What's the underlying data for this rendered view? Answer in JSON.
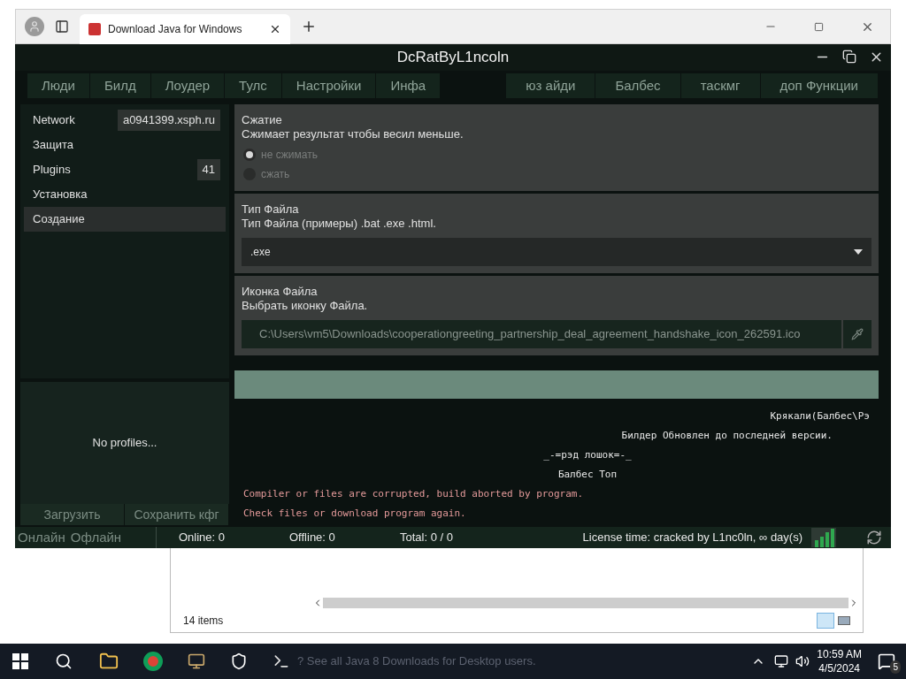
{
  "browser": {
    "tabs": [
      {
        "title": "Download Java for Windows",
        "selected": true
      }
    ]
  },
  "app": {
    "title": "DcRatByL1ncoln",
    "menu_left": [
      "Люди",
      "Билд",
      "Лоудер",
      "Тулс",
      "Настройки",
      "Инфа"
    ],
    "menu_right": [
      "юз айди",
      "Балбес",
      "таскмг",
      "доп Функции"
    ],
    "sidebar": {
      "items": [
        {
          "label": "Network",
          "value": "a0941399.xsph.ru",
          "selected": false
        },
        {
          "label": "Защита",
          "selected": false
        },
        {
          "label": "Plugins",
          "value": "41",
          "selected": false
        },
        {
          "label": "Установка",
          "selected": false
        },
        {
          "label": "Создание",
          "selected": true
        }
      ],
      "profiles_empty": "No profiles...",
      "buttons": [
        "Загрузить",
        "Сохранить кфг"
      ]
    },
    "sections": [
      {
        "kind": "radio",
        "title": "Сжатие",
        "description": "Сжимает результат чтобы весил меньше.",
        "options": [
          {
            "label": "не сжимать",
            "selected": true
          },
          {
            "label": "сжать",
            "selected": false
          }
        ]
      },
      {
        "kind": "select",
        "title": "Тип Файла",
        "description": "Тип Файла (примеры) .bat .exe .html.",
        "value": ".exe"
      },
      {
        "kind": "file",
        "title": "Иконка Файла",
        "description": "Выбрать иконку Файла.",
        "value": "C:\\Users\\vm5\\Downloads\\cooperationgreeting_partnership_deal_agreement_handshake_icon_262591.ico"
      }
    ],
    "log": [
      {
        "kind": "right",
        "text": "Крякали(Балбес\\Рэ"
      },
      {
        "kind": "notice",
        "text": "Билдер Обновлен до последней версии."
      },
      {
        "kind": "center",
        "text": "_-=рэд лошок=-_"
      },
      {
        "kind": "center",
        "text": "Балбес Топ"
      },
      {
        "kind": "error",
        "text": "Compiler or files are corrupted, build aborted by program."
      },
      {
        "kind": "error",
        "text": "Check files or download program again."
      }
    ],
    "status_bar": {
      "tabs": [
        "Онлайн",
        "Офлайн"
      ],
      "online": "Online: 0",
      "offline": "Offline: 0",
      "total": "Total: 0 / 0",
      "license": "License time: cracked by L1nc0ln, ∞ day(s)"
    }
  },
  "explorer": {
    "status": "14 items"
  },
  "background_text": "? See all Java 8 Downloads for Desktop users.",
  "taskbar": {
    "time": "10:59 AM",
    "date": "4/5/2024",
    "notifications": "5"
  }
}
